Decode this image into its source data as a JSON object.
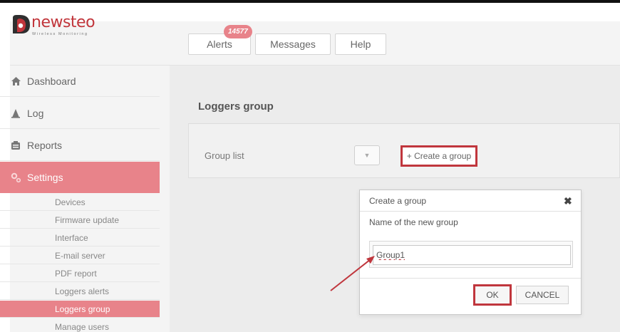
{
  "brand": {
    "name": "newsteo",
    "tagline": "Wireless Monitoring",
    "accent": "#e8838a",
    "highlight": "#c0363d"
  },
  "topbar": {
    "alerts_label": "Alerts",
    "alerts_badge": "14577",
    "messages_label": "Messages",
    "help_label": "Help"
  },
  "sidebar": {
    "items": [
      {
        "label": "Dashboard",
        "icon": "home-icon"
      },
      {
        "label": "Log",
        "icon": "log-icon"
      },
      {
        "label": "Reports",
        "icon": "reports-icon"
      },
      {
        "label": "Settings",
        "icon": "gear-icon",
        "active": true
      }
    ],
    "subitems": [
      {
        "label": "Devices"
      },
      {
        "label": "Firmware update"
      },
      {
        "label": "Interface"
      },
      {
        "label": "E-mail server"
      },
      {
        "label": "PDF report"
      },
      {
        "label": "Loggers alerts"
      },
      {
        "label": "Loggers group",
        "active": true
      },
      {
        "label": "Manage users"
      }
    ]
  },
  "main": {
    "panel_title": "Loggers group",
    "group_list_label": "Group list",
    "create_group_label": "+ Create a group"
  },
  "dialog": {
    "title": "Create a group",
    "field_label": "Name of the new group",
    "input_value": "Group1",
    "ok_label": "OK",
    "cancel_label": "CANCEL"
  }
}
